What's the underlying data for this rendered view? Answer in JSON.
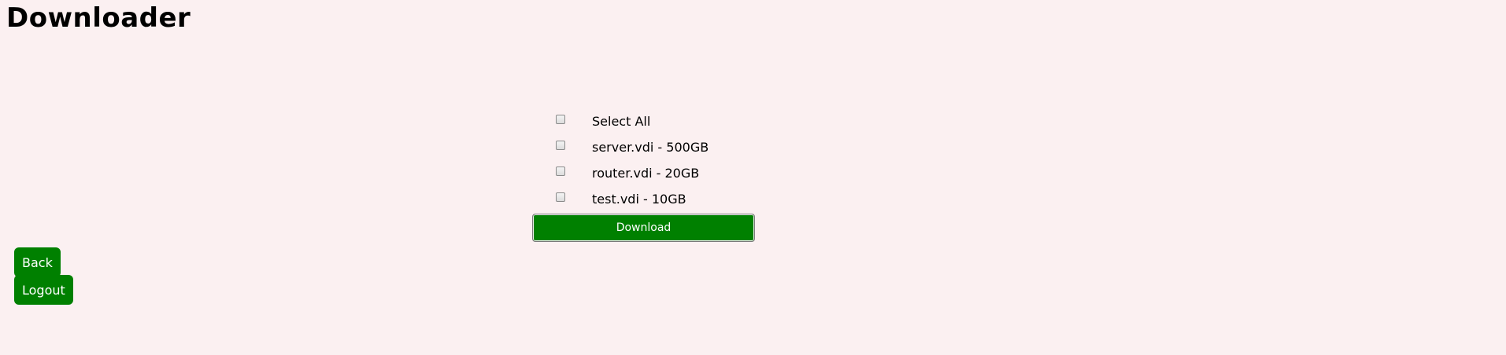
{
  "page": {
    "title": "Downloader"
  },
  "file_list": {
    "select_all_label": "Select All",
    "files": [
      {
        "label": "server.vdi - 500GB",
        "checked": false
      },
      {
        "label": "router.vdi - 20GB",
        "checked": false
      },
      {
        "label": "test.vdi - 10GB",
        "checked": false
      }
    ]
  },
  "actions": {
    "download_label": "Download",
    "back_label": "Back",
    "logout_label": "Logout"
  },
  "colors": {
    "background": "#fbf0f1",
    "button": "#008000",
    "button_text": "#ffffff"
  }
}
